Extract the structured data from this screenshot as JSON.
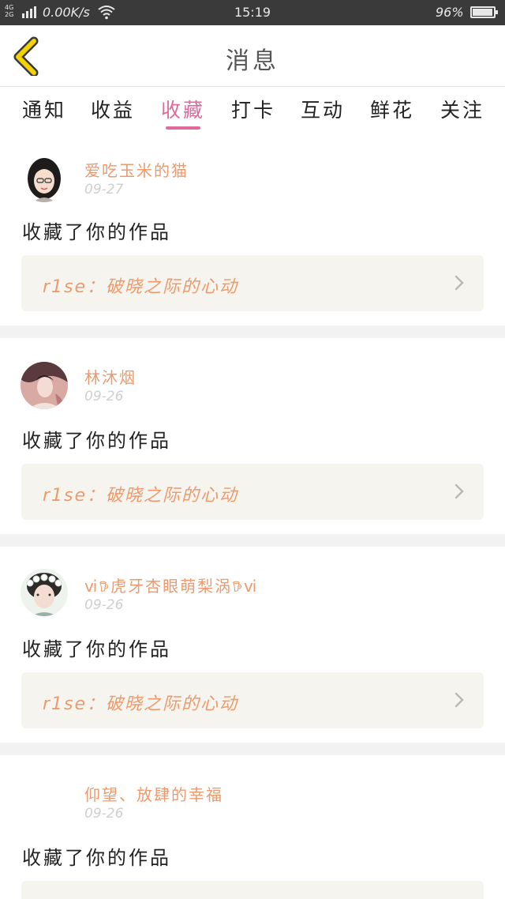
{
  "status_bar": {
    "network_type_top": "4G",
    "network_type_bottom": "2G",
    "speed": "0.00K/s",
    "time": "15:19",
    "battery_percent": "96%",
    "battery_level": 0.96
  },
  "header": {
    "title": "消息",
    "back_icon": "chevron-left-icon",
    "accent_color": "#f5d300"
  },
  "tabs": [
    {
      "label": "通知",
      "active": false
    },
    {
      "label": "收益",
      "active": false
    },
    {
      "label": "收藏",
      "active": true
    },
    {
      "label": "打卡",
      "active": false
    },
    {
      "label": "互动",
      "active": false
    },
    {
      "label": "鲜花",
      "active": false
    },
    {
      "label": "关注",
      "active": false
    }
  ],
  "colors": {
    "active_tab": "#e06b9a",
    "username": "#ec9a6e",
    "work_title": "#ec9a6e",
    "date": "#cfcfcf",
    "card_link_bg": "#f6f4ee"
  },
  "items": [
    {
      "username": "爱吃玉米的猫",
      "date": "09-27",
      "action": "收藏了你的作品",
      "work_title": "r1se：破晓之际的心动"
    },
    {
      "username": "林沐烟",
      "date": "09-26",
      "action": "收藏了你的作品",
      "work_title": "r1se：破晓之际的心动"
    },
    {
      "username": "ⅵ𖠚虎牙杏眼萌梨涡𖠚ⅵ",
      "date": "09-26",
      "action": "收藏了你的作品",
      "work_title": "r1se：破晓之际的心动"
    },
    {
      "username": "仰望、放肆的幸福",
      "date": "09-26",
      "action": "收藏了你的作品",
      "work_title": ""
    }
  ]
}
